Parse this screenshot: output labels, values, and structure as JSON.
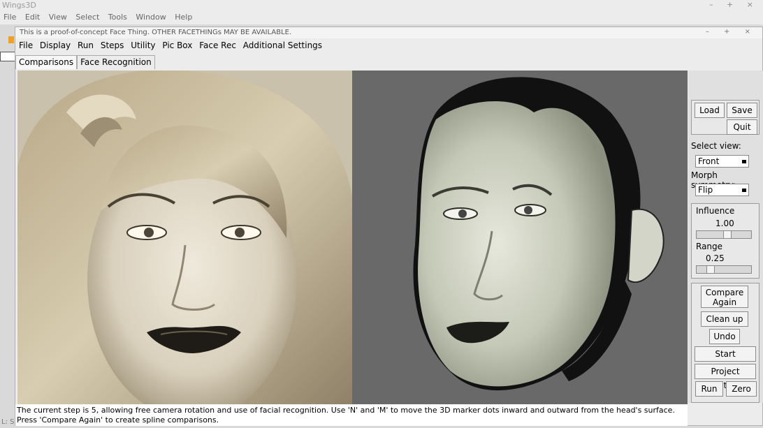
{
  "outer": {
    "title": "Wings3D",
    "menu": [
      "File",
      "Edit",
      "View",
      "Select",
      "Tools",
      "Window",
      "Help"
    ],
    "status_fragment": "L: S"
  },
  "inner": {
    "title": "This is a proof-of-concept Face Thing.  OTHER FACETHINGs MAY BE AVAILABLE.",
    "menu": [
      "File",
      "Display",
      "Run",
      "Steps",
      "Utility",
      "Pic Box",
      "Face Rec",
      "Additional Settings"
    ],
    "tabs": [
      "Comparisons",
      "Face Recognition"
    ]
  },
  "panel": {
    "load": "Load",
    "save": "Save",
    "quit": "Quit",
    "select_view_label": "Select view:",
    "select_view_value": "Front",
    "morph_label": "Morph symmetry:",
    "morph_value": "Flip",
    "influence_label": "Influence",
    "influence_value": "1.00",
    "range_label": "Range",
    "range_value": "0.25",
    "compare_again": "Compare Again",
    "clean_up": "Clean up",
    "undo": "Undo",
    "start_projector": "Start Projector",
    "project_texture": "Project Texture",
    "run": "Run",
    "zero": "Zero"
  },
  "status": {
    "line1": "The current step is 5, allowing free camera rotation and use of facial recognition.  Use 'N' and 'M' to move the 3D marker dots inward and outward from the head's surface.",
    "line2": "Press 'Compare Again' to create spline comparisons."
  }
}
